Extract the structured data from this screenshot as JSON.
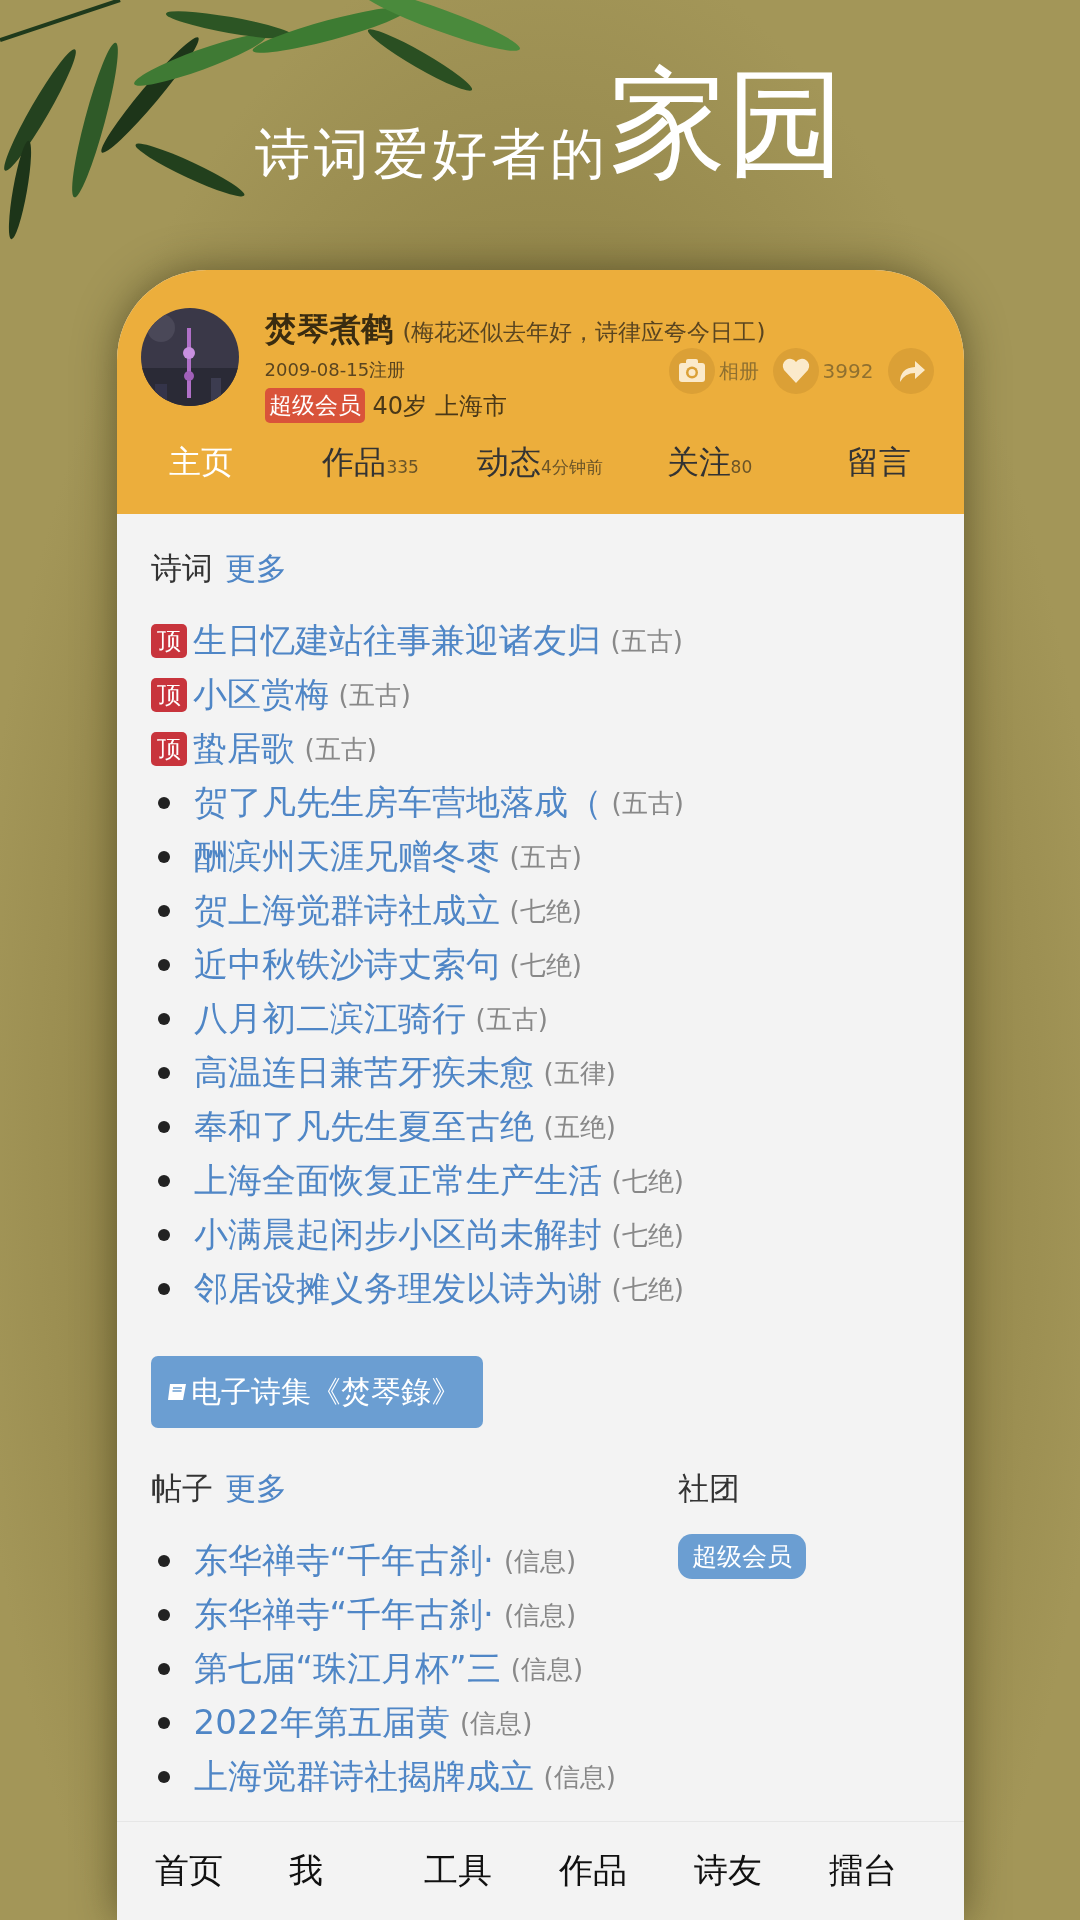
{
  "headline": {
    "text": "诗词爱好者的",
    "emphasis": "家园"
  },
  "profile": {
    "name": "焚琴煮鹤",
    "motto": "(梅花还似去年好，诗律应夸今日工)",
    "registered": "2009-08-15注册",
    "badge": "超级会员",
    "age": "40岁",
    "city": "上海市",
    "actions": [
      {
        "kind": "camera",
        "label": "相册"
      },
      {
        "kind": "heart",
        "label": "3992"
      },
      {
        "kind": "share"
      }
    ]
  },
  "tabs": [
    {
      "label": "主页",
      "selected": true
    },
    {
      "label": "作品",
      "note": "335",
      "selected": false
    },
    {
      "label": "动态",
      "note": "4分钟前",
      "selected": false
    },
    {
      "label": "关注",
      "note": "80",
      "selected": false
    },
    {
      "label": "留言",
      "selected": false
    }
  ],
  "poems": {
    "title": "诗词",
    "more": "更多",
    "items": [
      {
        "title": "生日忆建站往事兼迎诸友归",
        "form": "(五古)",
        "pinned": true,
        "badge": "顶"
      },
      {
        "title": "小区赏梅",
        "form": "(五古)",
        "pinned": true,
        "badge": "顶"
      },
      {
        "title": "蛰居歌",
        "form": "(五古)",
        "pinned": true,
        "badge": "顶"
      },
      {
        "title": "贺了凡先生房车营地落成（",
        "form": "(五古)",
        "pinned": false
      },
      {
        "title": "酬滨州天涯兄赠冬枣",
        "form": "(五古)",
        "pinned": false
      },
      {
        "title": "贺上海觉群诗社成立",
        "form": "(七绝)",
        "pinned": false
      },
      {
        "title": "近中秋铁沙诗丈索句",
        "form": "(七绝)",
        "pinned": false
      },
      {
        "title": "八月初二滨江骑行",
        "form": "(五古)",
        "pinned": false
      },
      {
        "title": "高温连日兼苦牙疾未愈",
        "form": "(五律)",
        "pinned": false
      },
      {
        "title": "奉和了凡先生夏至古绝",
        "form": "(五绝)",
        "pinned": false
      },
      {
        "title": "上海全面恢复正常生产生活",
        "form": "(七绝)",
        "pinned": false
      },
      {
        "title": "小满晨起闲步小区尚未解封",
        "form": "(七绝)",
        "pinned": false
      },
      {
        "title": "邻居设摊义务理发以诗为谢",
        "form": "(七绝)",
        "pinned": false
      }
    ]
  },
  "ebook_button": "电子诗集《焚琴錄》",
  "posts": {
    "title": "帖子",
    "more": "更多",
    "items": [
      {
        "title": "东华禅寺“千年古刹·",
        "tag": "(信息)"
      },
      {
        "title": "东华禅寺“千年古刹·",
        "tag": "(信息)"
      },
      {
        "title": "第七届“珠江月杯”三",
        "tag": "(信息)"
      },
      {
        "title": "2022年第五届黄",
        "tag": "(信息)"
      },
      {
        "title": "上海觉群诗社揭牌成立",
        "tag": "(信息)"
      }
    ]
  },
  "groups": {
    "title": "社团",
    "items": [
      "超级会员"
    ]
  },
  "bottom_nav": [
    {
      "label": "首页"
    },
    {
      "label": "我"
    },
    {
      "label": "工具"
    },
    {
      "label": "作品"
    },
    {
      "label": "诗友"
    },
    {
      "label": "擂台"
    }
  ]
}
